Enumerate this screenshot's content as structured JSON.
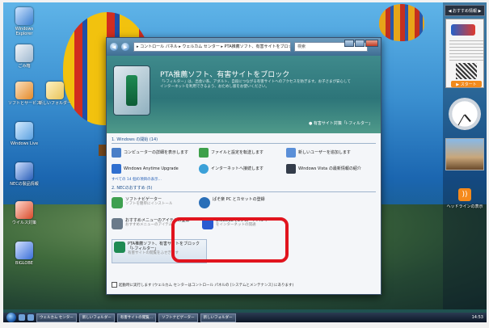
{
  "desktop_icons": [
    {
      "label": "Windows Explorer",
      "color": "#3a7fd0"
    },
    {
      "label": "ごみ箱",
      "color": "#9fb8d0"
    },
    {
      "label": "ソフトとサービス",
      "color": "#e58a2a"
    },
    {
      "label": "新しいフォルダー",
      "color": "#e8c35a"
    },
    {
      "label": "Windows Live",
      "color": "#5aa0e0"
    },
    {
      "label": "NECの製品情報",
      "color": "#2a5fb8"
    },
    {
      "label": "ウイルス対策",
      "color": "#d94a2a"
    },
    {
      "label": "BIGLOBE",
      "color": "#3a6fd8"
    }
  ],
  "window": {
    "address": "▸ コントロール パネル ▸ ウェルカム センター ▸ PTA推薦ソフト、有害サイトをブロック",
    "search_placeholder": "検索",
    "hero_title": "PTA推薦ソフト、有害サイトをブロック",
    "hero_desc": "「i-フィルター」は、出会い系、アダルト、自殺につながる有害サイトへのアクセスを防ぎます。お子さまが安心してインターネットを利用できるよう、おためし版をお使いください。",
    "hero_link": "● 有害サイト対策「i-フィルター」",
    "section1_title": "1. Windows の開始 (14)",
    "tasks": [
      {
        "label": "コンピューターの詳細を表示します",
        "color": "#4a7fc8"
      },
      {
        "label": "ファイルと設定を転送します",
        "color": "#3ea04a"
      },
      {
        "label": "新しいユーザーを追加します",
        "color": "#5a8fd8"
      },
      {
        "label": "Windows Anytime Upgrade",
        "color": "#2f6fd0"
      },
      {
        "label": "インターネットへ接続します",
        "color": "#3aa0d8"
      },
      {
        "label": "Windows Vista の最新情報の紹介",
        "color": "#333c4a"
      }
    ],
    "more_tasks": "すべての 14 個の項目の表示...",
    "section2_title": "2. NECのおすすめ (5)",
    "offers": [
      {
        "title": "ソフトナビゲーター",
        "sub": "ソフトを簡単にインストール",
        "color": "#3fa050"
      },
      {
        "title": "ぱそ楽 PC とカセットの登録",
        "sub": "",
        "color": "#2a6fb8"
      },
      {
        "title": "おすすめメニューのアイテムの登録",
        "sub": "おすすめメニューのアイテム",
        "color": "#6a7a8a"
      },
      {
        "title": "BIGLOBEでEブロードバンド",
        "sub": "をインターネットの開通",
        "color": "#2a5ad0"
      },
      {
        "title": "PTA推薦ソフト、有害サイトをブロック「i-フィルター」",
        "sub": "有害サイトの閲覧をふせぎます",
        "color": "#1e8a52"
      }
    ],
    "footer": "起動時に実行します (ウェルカム センターはコントロール パネルの [システムとメンテナンス] にあります)"
  },
  "sidebar": {
    "header": "◀ おすすめ情報 ▶",
    "gadget_start": "▶ スタート",
    "rss_caption": "ヘッドラインの表示"
  },
  "taskbar": {
    "buttons": [
      "ウェルカム センター",
      "新しいフォルダー",
      "有害サイトの閲覧...",
      "ソフトナビゲーター",
      "新しいフォルダー"
    ],
    "time": "14:53"
  }
}
